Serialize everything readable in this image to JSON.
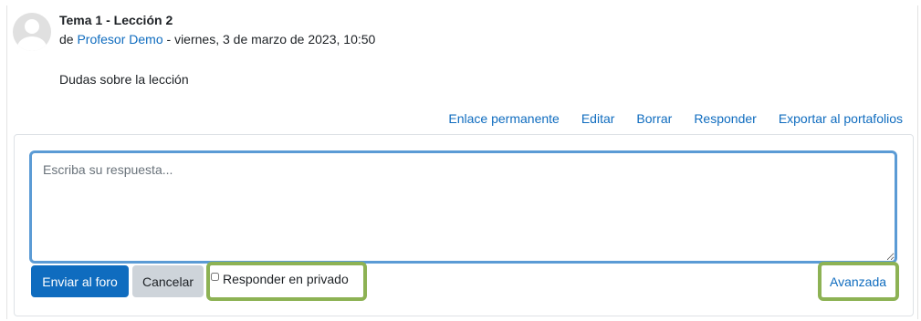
{
  "post": {
    "title": "Tema 1 - Lección 2",
    "byline_prefix": "de ",
    "author": "Profesor Demo",
    "byline_suffix": " - viernes, 3 de marzo de 2023, 10:50",
    "message": "Dudas sobre la lección",
    "commands": [
      "Enlace permanente",
      "Editar",
      "Borrar",
      "Responder",
      "Exportar al portafolios"
    ]
  },
  "reply": {
    "placeholder": "Escriba su respuesta...",
    "submit_label": "Enviar al foro",
    "cancel_label": "Cancelar",
    "private_label": "Responder en privado",
    "private_checked": false,
    "advanced_label": "Avanzada"
  },
  "colors": {
    "link": "#0f6cbf",
    "primary_button": "#0f6cbf",
    "secondary_button": "#ced4da",
    "input_focus_border": "#5b9bd5",
    "highlight": "#8db254"
  }
}
